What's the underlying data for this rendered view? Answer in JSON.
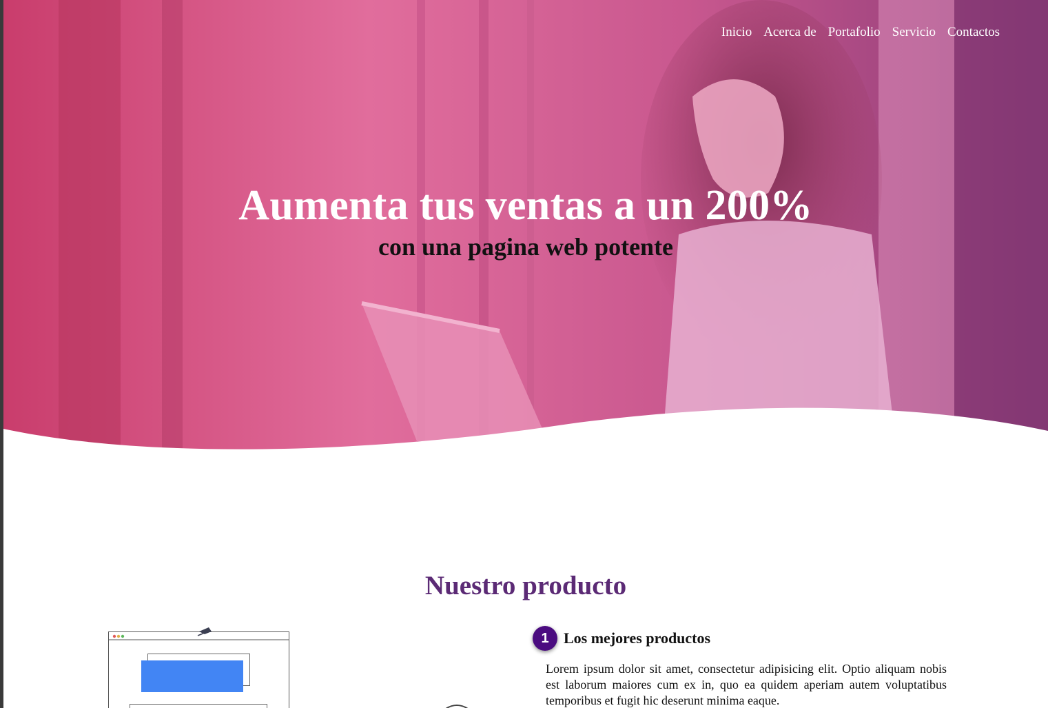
{
  "nav": {
    "items": [
      "Inicio",
      "Acerca de",
      "Portafolio",
      "Servicio",
      "Contactos"
    ]
  },
  "hero": {
    "title": "Aumenta tus ventas a un 200%",
    "subtitle": "con una pagina web potente"
  },
  "product": {
    "section_title": "Nuestro producto",
    "features": [
      {
        "number": "1",
        "title": "Los mejores productos",
        "text": "Lorem ipsum dolor sit amet, consectetur adipisicing elit. Optio aliquam nobis est laborum maiores cum ex in, quo ea quidem aperiam autem voluptatibus temporibus et fugit hic deserunt minima eaque."
      }
    ]
  },
  "colors": {
    "hero_overlay_start": "#d94a7e",
    "hero_overlay_end": "#8a3a75",
    "section_title": "#5b2a75",
    "badge": "#4b0c80",
    "illustration_accent": "#4285f4"
  }
}
